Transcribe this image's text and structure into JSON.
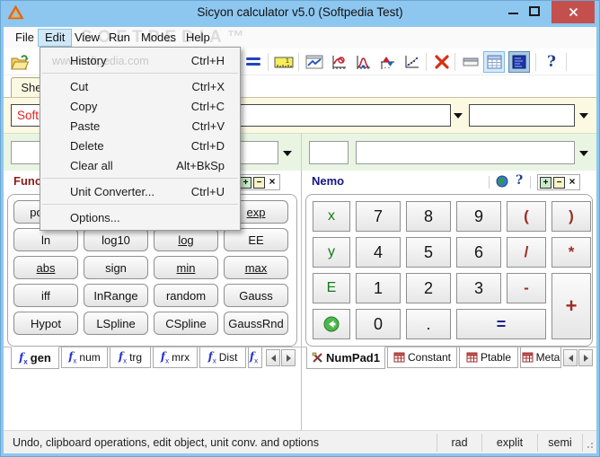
{
  "window": {
    "title": "Sicyon calculator v5.0 (Softpedia Test)"
  },
  "watermarks": {
    "brand": "SOFTPEDIA™",
    "url": "www.softpedia.com"
  },
  "menubar": {
    "items": [
      "File",
      "Edit",
      "View",
      "Run",
      "Modes",
      "Help"
    ],
    "active_item": "Edit"
  },
  "edit_menu": {
    "items": [
      {
        "label": "History",
        "shortcut": "Ctrl+H"
      },
      {
        "label": "Cut",
        "shortcut": "Ctrl+X"
      },
      {
        "label": "Copy",
        "shortcut": "Ctrl+C"
      },
      {
        "label": "Paste",
        "shortcut": "Ctrl+V"
      },
      {
        "label": "Delete",
        "shortcut": "Ctrl+D"
      },
      {
        "label": "Clear all",
        "shortcut": "Alt+BkSp"
      },
      {
        "label": "Unit Converter...",
        "shortcut": "Ctrl+U"
      },
      {
        "label": "Options...",
        "shortcut": ""
      }
    ]
  },
  "toolbar": {
    "ruler_label": "1",
    "help_glyph": "?",
    "icons": [
      "open-file",
      "expression-list",
      "unit-converter",
      "chart-window",
      "plot-explore",
      "plot-distribution",
      "plot-integrate",
      "plot-fit",
      "delete",
      "panel-mini",
      "panel-sheet",
      "panel-list",
      "help"
    ]
  },
  "workspace": {
    "sheet_tab": "Sheet1",
    "expression_value": "Softpedia"
  },
  "functions_panel": {
    "title": "Functions",
    "controls": {
      "maximize": "+",
      "minimize": "−",
      "close": "×"
    },
    "buttons": [
      {
        "label": "power"
      },
      {
        "label": ""
      },
      {
        "label": ""
      },
      {
        "label": "exp"
      },
      {
        "label": "ln"
      },
      {
        "label": "log10"
      },
      {
        "label": "log"
      },
      {
        "label": "EE"
      },
      {
        "label": "abs"
      },
      {
        "label": "sign"
      },
      {
        "label": "min"
      },
      {
        "label": "max"
      },
      {
        "label": "iff"
      },
      {
        "label": "InRange"
      },
      {
        "label": "random"
      },
      {
        "label": "Gauss"
      },
      {
        "label": "Hypot"
      },
      {
        "label": "LSpline"
      },
      {
        "label": "CSpline"
      },
      {
        "label": "GaussRnd"
      }
    ],
    "fx_icon": {
      "f": "f",
      "x": "x"
    },
    "tabs": [
      "gen",
      "num",
      "trg",
      "mrx",
      "Dist",
      ""
    ]
  },
  "nemo_panel": {
    "title": "Nemo",
    "help_glyph": "?",
    "controls": {
      "maximize": "+",
      "minimize": "−",
      "close": "×"
    },
    "keys": {
      "r1": [
        "x",
        "7",
        "8",
        "9",
        "(",
        ")"
      ],
      "r2": [
        "y",
        "4",
        "5",
        "6",
        "/",
        "*"
      ],
      "r3": [
        "E",
        "1",
        "2",
        "3",
        "-",
        "+"
      ],
      "r4": [
        "0",
        ".",
        "="
      ]
    },
    "tabs": [
      "NumPad1",
      "Constant",
      "Ptable",
      "Meta"
    ]
  },
  "statusbar": {
    "message": "Undo, clipboard operations, edit object, unit conv. and options",
    "cells": [
      "rad",
      "explit",
      "semi"
    ]
  }
}
